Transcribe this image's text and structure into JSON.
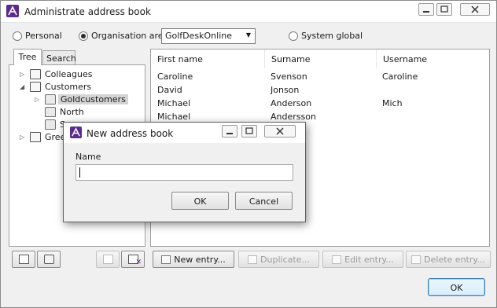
{
  "window": {
    "title": "Administrate address book",
    "brand_color": "#5b2a8c"
  },
  "scope": {
    "options": [
      {
        "label": "Personal",
        "checked": false
      },
      {
        "label": "Organisation area",
        "checked": true
      },
      {
        "label": "System global",
        "checked": false
      }
    ],
    "organisation_area_value": "GolfDeskOnline"
  },
  "tabs": [
    "Tree",
    "Search"
  ],
  "tree": {
    "items": [
      {
        "label": "Colleagues",
        "icon": "contact-card-icon",
        "expander": "collapsed"
      },
      {
        "label": "Customers",
        "icon": "contact-card-icon",
        "expander": "expanded"
      },
      {
        "label": "Goldcustomers",
        "icon": "folder-open-icon",
        "expander": "collapsed",
        "selected": true
      },
      {
        "label": "North",
        "icon": "folder-icon",
        "expander": "none"
      },
      {
        "label": "S",
        "icon": "folder-icon",
        "expander": "none"
      },
      {
        "label": "Gree",
        "icon": "contact-card-icon",
        "expander": "collapsed"
      }
    ]
  },
  "entries": {
    "columns": [
      "First name",
      "Surname",
      "Username"
    ],
    "rows": [
      [
        "Caroline",
        "Svenson",
        "Caroline"
      ],
      [
        "David",
        "Jonson",
        ""
      ],
      [
        "Michael",
        "Anderson",
        "Mich"
      ],
      [
        "Michael",
        "Andersson",
        ""
      ]
    ]
  },
  "actions": {
    "new_entry": "New entry...",
    "duplicate": "Duplicate...",
    "edit_entry": "Edit entry...",
    "delete_entry": "Delete entry..."
  },
  "ok_label": "OK",
  "dialog": {
    "title": "New address book",
    "name_label": "Name",
    "name_value": "",
    "ok_label": "OK",
    "cancel_label": "Cancel"
  }
}
